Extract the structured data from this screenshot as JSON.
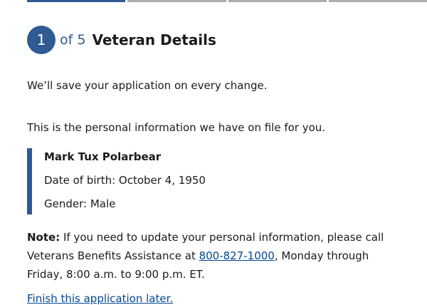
{
  "progress": {
    "current_step": 1,
    "total_steps": 5
  },
  "step": {
    "number": "1",
    "of_text": "of 5",
    "title": "Veteran Details"
  },
  "save_note": "We’ll save your application on every change.",
  "intro": "This is the personal information we have on file for you.",
  "veteran": {
    "name": "Mark Tux Polarbear",
    "dob": "Date of birth: October 4, 1950",
    "gender": "Gender: Male"
  },
  "note": {
    "label": "Note:",
    "text_before": " If you need to update your personal information, please call Veterans Benefits Assistance at ",
    "phone": "800-827-1000",
    "text_after": ", Monday through Friday, 8:00 a.m. to 9:00 p.m. ET."
  },
  "finish_link": "Finish this application later."
}
